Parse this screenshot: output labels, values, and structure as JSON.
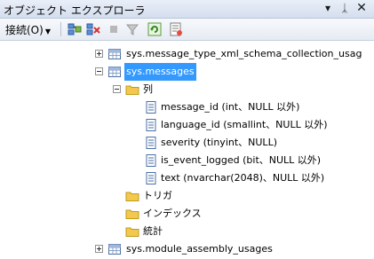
{
  "window": {
    "title": "オブジェクト エクスプローラ"
  },
  "toolbar": {
    "connect_label": "接続(O)"
  },
  "tree": {
    "xml_collection": "sys.message_type_xml_schema_collection_usag",
    "messages": "sys.messages",
    "columns_folder": "列",
    "columns": [
      "message_id (int、NULL 以外)",
      "language_id (smallint、NULL 以外)",
      "severity (tinyint、NULL)",
      "is_event_logged (bit、NULL 以外)",
      "text (nvarchar(2048)、NULL 以外)"
    ],
    "triggers_folder": "トリガ",
    "indexes_folder": "インデックス",
    "stats_folder": "統計",
    "module_usages": "sys.module_assembly_usages"
  },
  "colors": {
    "selection": "#3399ff",
    "folder": "#f2c94c"
  },
  "icons": [
    "dropdown-arrow-icon",
    "pin-icon",
    "close-icon",
    "connect-icon",
    "disconnect-icon",
    "stop-icon",
    "filter-icon",
    "refresh-icon",
    "summary-icon",
    "table-icon",
    "folder-icon",
    "column-icon"
  ]
}
